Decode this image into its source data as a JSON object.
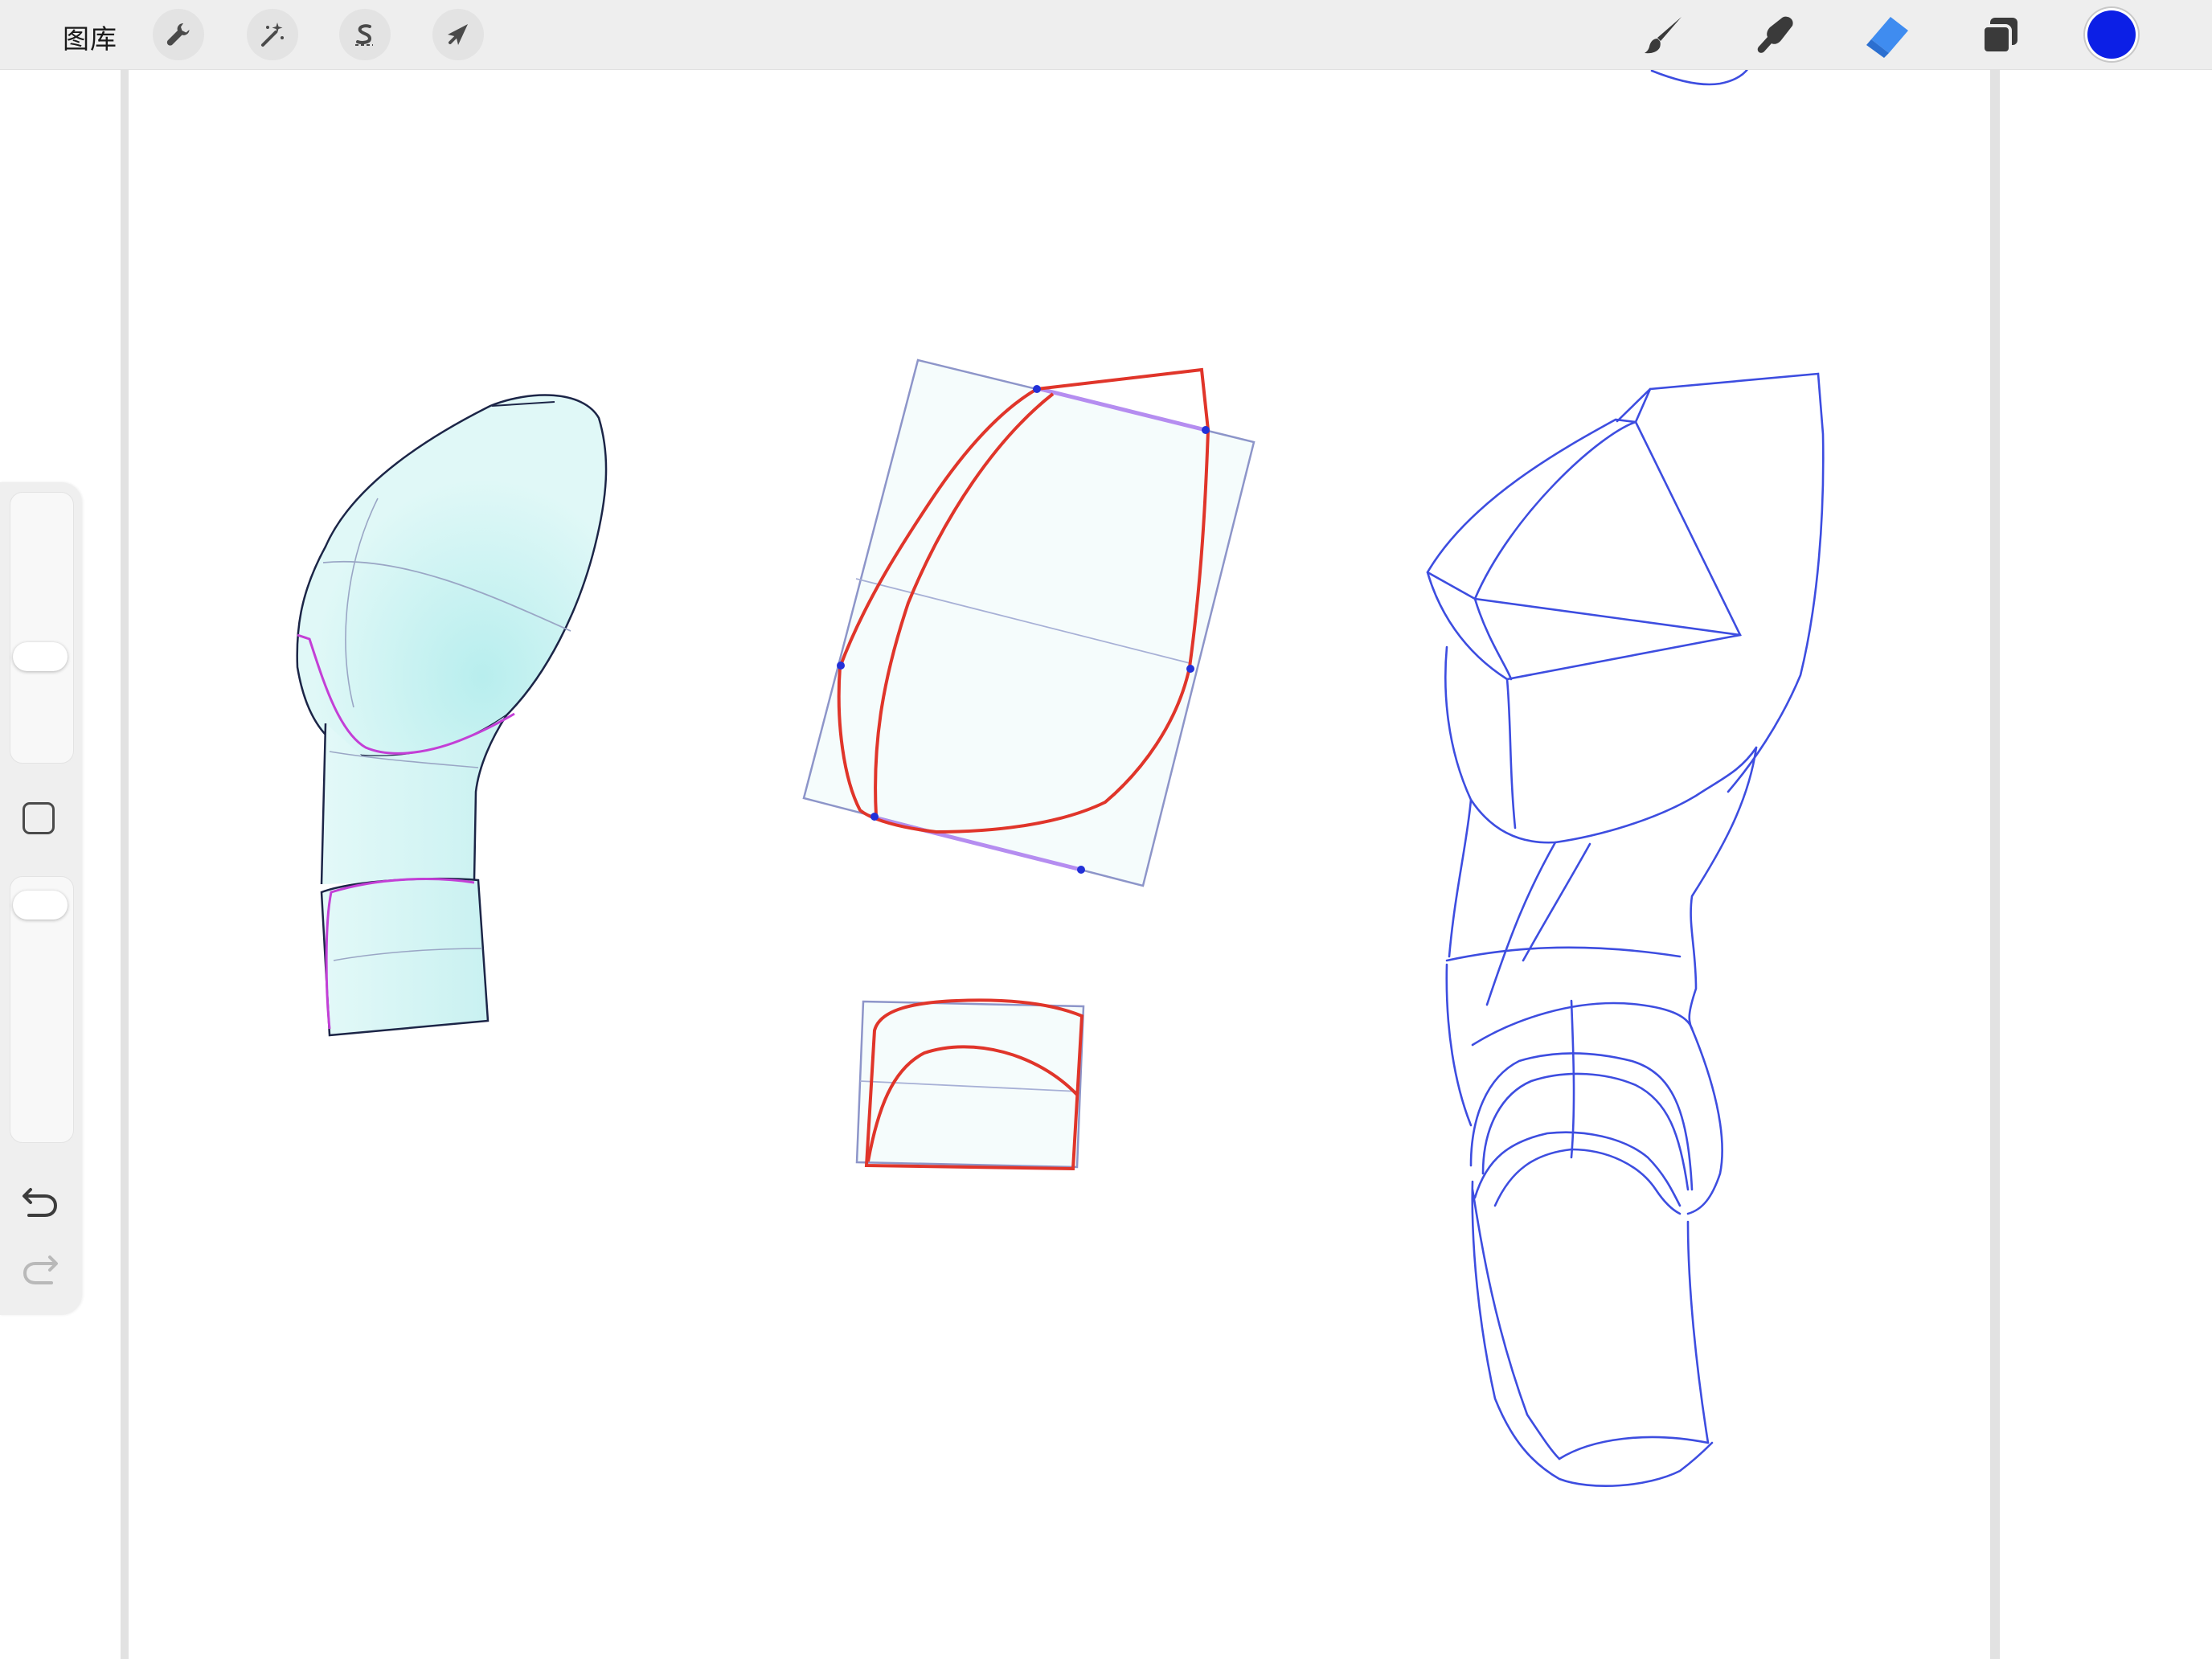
{
  "toolbar": {
    "gallery_label": "图库",
    "left_tools": [
      {
        "name": "actions",
        "icon": "wrench-icon"
      },
      {
        "name": "adjustments",
        "icon": "magic-wand-icon"
      },
      {
        "name": "selection",
        "icon": "selection-s-icon"
      },
      {
        "name": "transform",
        "icon": "arrow-cursor-icon"
      }
    ],
    "right_tools": [
      {
        "name": "brush",
        "icon": "brush-icon",
        "active": false
      },
      {
        "name": "smudge",
        "icon": "smudge-finger-icon",
        "active": false
      },
      {
        "name": "eraser",
        "icon": "eraser-icon",
        "active": true
      },
      {
        "name": "layers",
        "icon": "layers-icon",
        "active": false
      }
    ],
    "current_color": "#0c1fe6",
    "active_tool_color": "#3f8cf0"
  },
  "sidebar": {
    "brush_size_level": 0.38,
    "brush_opacity_level": 0.94,
    "modify_icon": "square-outline-icon",
    "undo_icon": "undo-icon",
    "redo_icon": "redo-icon",
    "redo_enabled": false
  },
  "canvas": {
    "background": "#ffffff",
    "sketches": [
      {
        "name": "shaded-arm-form",
        "fill": "#dff7f6",
        "outline": "#1c2547",
        "accent": "#c33fd6"
      },
      {
        "name": "red-construction-boxes",
        "stroke": "#e0352a",
        "box": "#8d95c9",
        "highlight": "#b58df0"
      },
      {
        "name": "blue-line-arm-sketch",
        "stroke": "#3d4de0"
      }
    ]
  }
}
